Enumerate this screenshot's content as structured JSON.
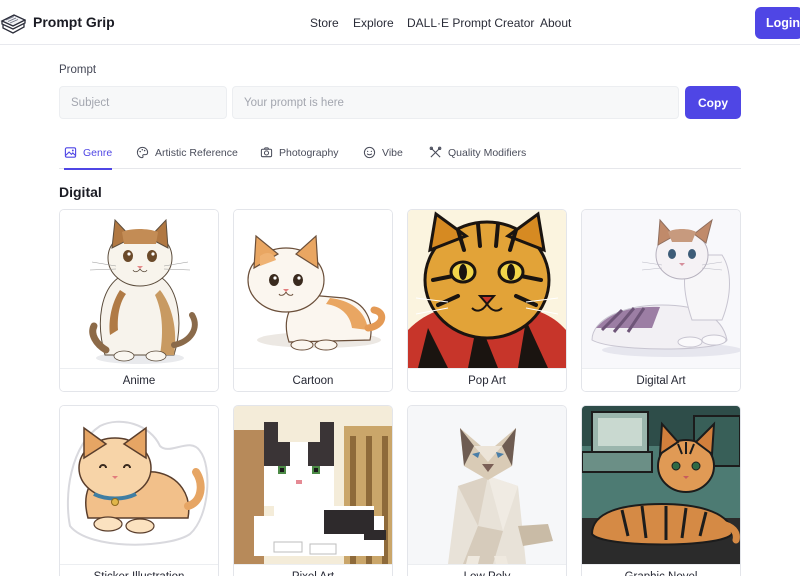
{
  "header": {
    "brand": "Prompt Grip",
    "nav": [
      "Store",
      "Explore",
      "DALL·E Prompt Creator",
      "About"
    ],
    "login_label": "Login"
  },
  "prompt": {
    "label": "Prompt",
    "subject_placeholder": "Subject",
    "prompt_placeholder": "Your prompt is here",
    "copy_label": "Copy"
  },
  "tabs": [
    {
      "label": "Genre",
      "icon": "image-icon",
      "active": true
    },
    {
      "label": "Artistic Reference",
      "icon": "palette-icon",
      "active": false
    },
    {
      "label": "Photography",
      "icon": "camera-icon",
      "active": false
    },
    {
      "label": "Vibe",
      "icon": "smile-icon",
      "active": false
    },
    {
      "label": "Quality Modifiers",
      "icon": "tools-icon",
      "active": false
    }
  ],
  "section_title": "Digital",
  "cards": [
    {
      "label": "Anime"
    },
    {
      "label": "Cartoon"
    },
    {
      "label": "Pop Art"
    },
    {
      "label": "Digital Art"
    },
    {
      "label": "Sticker Illustration"
    },
    {
      "label": "Pixel Art"
    },
    {
      "label": "Low Poly"
    },
    {
      "label": "Graphic Novel"
    }
  ],
  "colors": {
    "accent": "#4f46e5"
  }
}
